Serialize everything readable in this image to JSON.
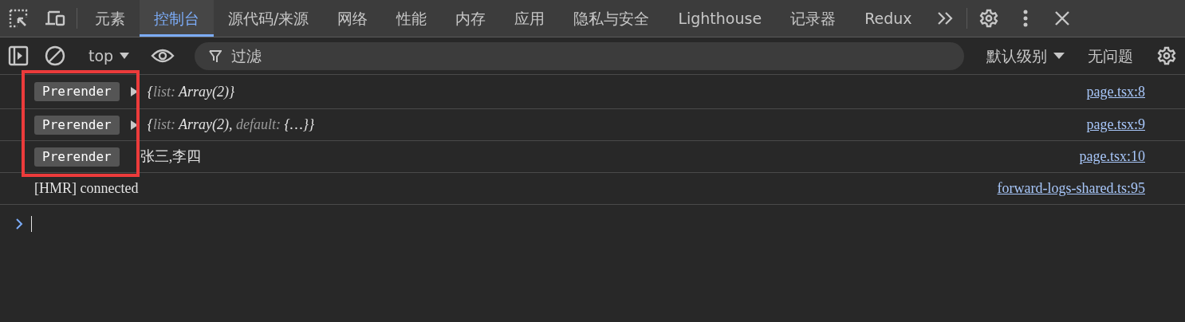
{
  "tabs": [
    {
      "label": "元素",
      "selected": false
    },
    {
      "label": "控制台",
      "selected": true
    },
    {
      "label": "源代码/来源",
      "selected": false
    },
    {
      "label": "网络",
      "selected": false
    },
    {
      "label": "性能",
      "selected": false
    },
    {
      "label": "内存",
      "selected": false
    },
    {
      "label": "应用",
      "selected": false
    },
    {
      "label": "隐私与安全",
      "selected": false
    },
    {
      "label": "Lighthouse",
      "selected": false
    },
    {
      "label": "记录器",
      "selected": false
    },
    {
      "label": "Redux",
      "selected": false
    }
  ],
  "toolbar": {
    "context": "top",
    "filter": {
      "placeholder": "过滤"
    },
    "levels": "默认级别",
    "issues": "无问题"
  },
  "messages": [
    {
      "badge": "Prerender",
      "expandable": true,
      "segments": [
        {
          "text": "{",
          "kind": "value"
        },
        {
          "text": "list:",
          "kind": "key"
        },
        {
          "text": " Array(2)}",
          "kind": "value"
        }
      ],
      "source": "page.tsx:8"
    },
    {
      "badge": "Prerender",
      "expandable": true,
      "segments": [
        {
          "text": "{",
          "kind": "value"
        },
        {
          "text": "list:",
          "kind": "key"
        },
        {
          "text": " Array(2), ",
          "kind": "value"
        },
        {
          "text": "default: ",
          "kind": "dim"
        },
        {
          "text": "{…}}",
          "kind": "value"
        }
      ],
      "source": "page.tsx:9"
    },
    {
      "badge": "Prerender",
      "expandable": false,
      "segments": [
        {
          "text": "张三,李四",
          "kind": "plain"
        }
      ],
      "source": "page.tsx:10"
    },
    {
      "expandable": false,
      "segments": [
        {
          "text": "[HMR] connected",
          "kind": "plain"
        }
      ],
      "source": "forward-logs-shared.ts:95"
    }
  ],
  "annotation": {
    "kind": "highlight-frame"
  }
}
